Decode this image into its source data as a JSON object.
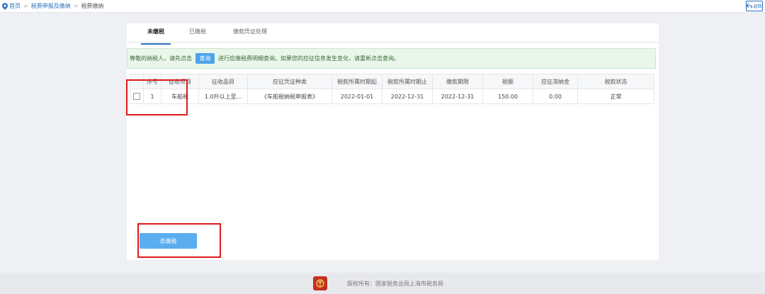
{
  "breadcrumb": {
    "home": "首页",
    "level2": "税费申报及缴纳",
    "current": "税费缴纳"
  },
  "back_label": "返回",
  "tabs": [
    {
      "label": "未缴税",
      "active": true
    },
    {
      "label": "已缴税",
      "active": false
    },
    {
      "label": "缴款凭证处理",
      "active": false
    }
  ],
  "notice": {
    "before": "尊敬的纳税人，请先点击",
    "button": "查询",
    "after": "进行应缴税费明细查询。如果您的应征信息发生变化，请重新点击查询。"
  },
  "table": {
    "headers": [
      "序号",
      "征收项目",
      "征收品目",
      "应征凭证种类",
      "税款所属时期起",
      "税款所属时期止",
      "缴款期限",
      "税额",
      "应征滞纳金",
      "税款状态"
    ],
    "rows": [
      [
        "1",
        "车船税",
        "1.0升以上至...",
        "《车船税纳税申报表》",
        "2022-01-01",
        "2022-12-31",
        "2022-12-31",
        "150.00",
        "0.00",
        "正常"
      ]
    ]
  },
  "pay_button": "去缴税",
  "footer": {
    "copyright": "版权所有：国家税务总局上海市税务局"
  },
  "colors": {
    "accent": "#2a6fc2",
    "button": "#4aa3ea",
    "highlight": "#e0191c",
    "notice_bg": "#e9f6e9"
  }
}
